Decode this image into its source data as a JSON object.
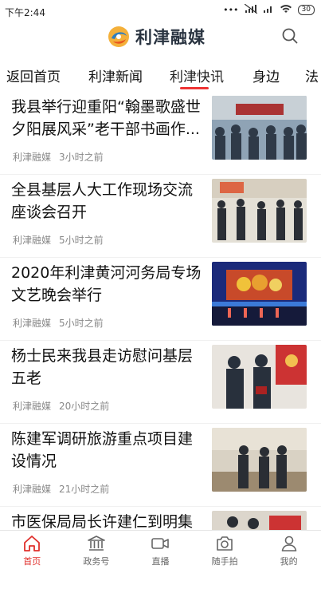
{
  "status": {
    "time": "下午2:44",
    "battery": "30"
  },
  "app": {
    "name": "利津融媒"
  },
  "tabs": [
    {
      "label": "返回首页"
    },
    {
      "label": "利津新闻"
    },
    {
      "label": "利津快讯"
    },
    {
      "label": "身边"
    },
    {
      "label": "法"
    }
  ],
  "active_tab_index": 2,
  "news": [
    {
      "title": "我县举行迎重阳“翰墨歌盛世夕阳展风采”老干部书画作...",
      "source": "利津融媒",
      "time": "3小时之前"
    },
    {
      "title": "全县基层人大工作现场交流座谈会召开",
      "source": "利津融媒",
      "time": "5小时之前"
    },
    {
      "title": "2020年利津黄河河务局专场文艺晚会举行",
      "source": "利津融媒",
      "time": "5小时之前"
    },
    {
      "title": "杨士民来我县走访慰问基层五老",
      "source": "利津融媒",
      "time": "20小时之前"
    },
    {
      "title": "陈建军调研旅游重点项目建设情况",
      "source": "利津融媒",
      "time": "21小时之前"
    },
    {
      "title": "市医保局局长许建仁到明集",
      "source": "",
      "time": ""
    }
  ],
  "bottom_nav": [
    {
      "label": "首页",
      "icon": "home-icon"
    },
    {
      "label": "政务号",
      "icon": "government-building-icon"
    },
    {
      "label": "直播",
      "icon": "video-camera-icon"
    },
    {
      "label": "随手拍",
      "icon": "camera-icon"
    },
    {
      "label": "我的",
      "icon": "user-icon"
    }
  ],
  "colors": {
    "accent": "#e0302c",
    "text": "#111111",
    "meta": "#888888"
  }
}
